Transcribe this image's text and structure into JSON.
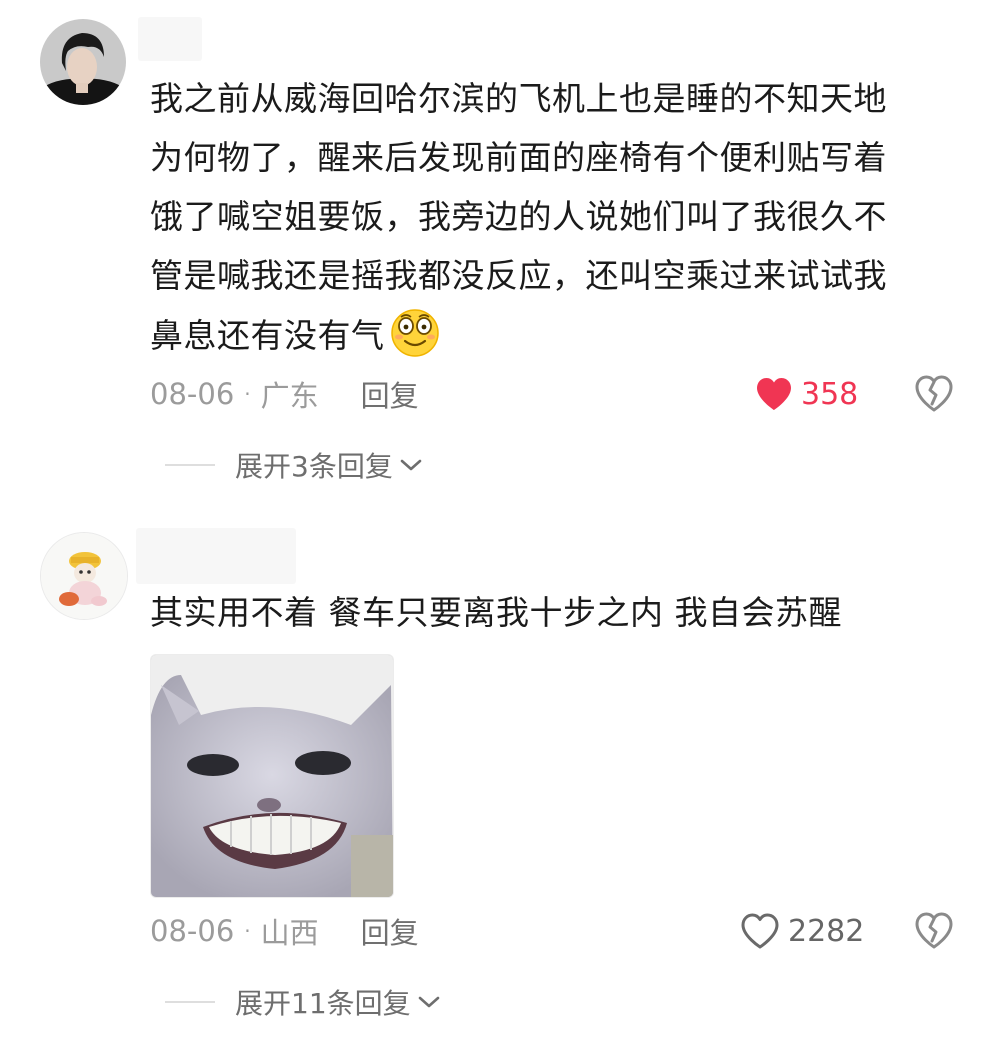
{
  "comments": [
    {
      "text_lines": [
        "我之前从威海回哈尔滨的飞机上也是睡的不知天地",
        "为何物了，醒来后发现前面的座椅有个便利贴写着",
        "饿了喊空姐要饭，我旁边的人说她们叫了我很久不",
        "管是喊我还是摇我都没反应，还叫空乘过来试试我",
        "鼻息还有没有气"
      ],
      "emoji": "dazed-face-emoji",
      "date": "08-06",
      "location": "广东",
      "reply_label": "回复",
      "likes": "358",
      "liked": true,
      "like_color": "#f03553",
      "expand_label": "展开3条回复"
    },
    {
      "text": "其实用不着 餐车只要离我十步之内 我自会苏醒",
      "image": "smiling-cat-meme",
      "date": "08-06",
      "location": "山西",
      "reply_label": "回复",
      "likes": "2282",
      "liked": false,
      "expand_label": "展开11条回复"
    }
  ]
}
